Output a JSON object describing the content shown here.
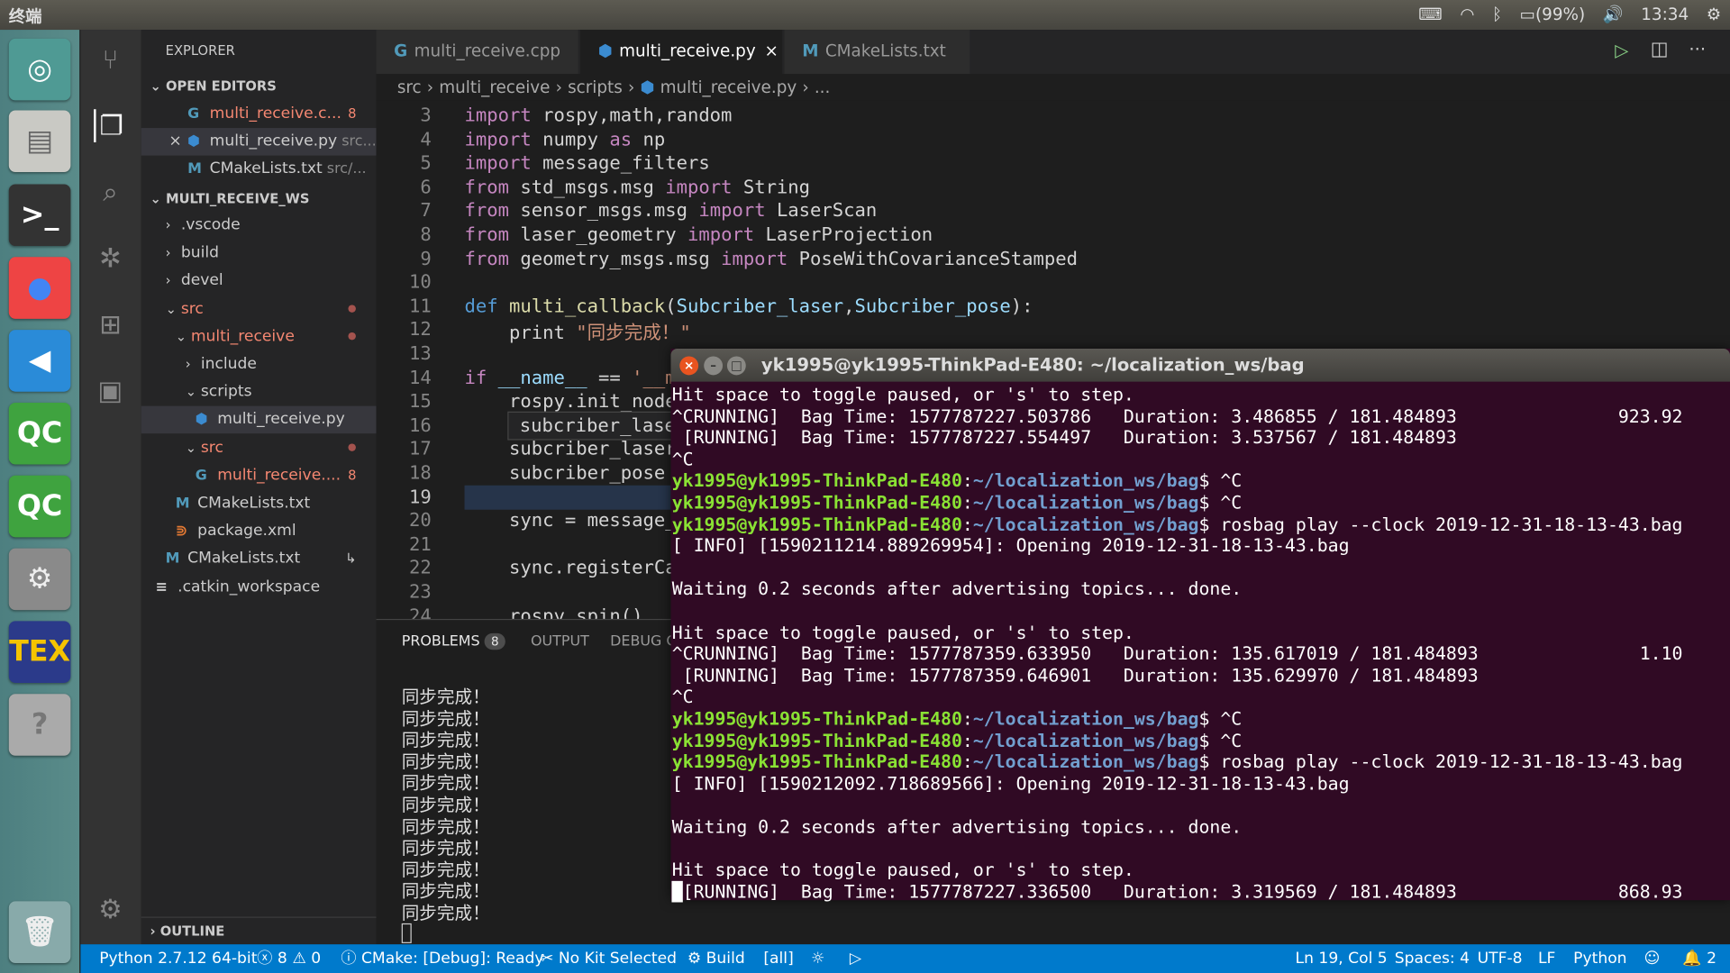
{
  "topbar": {
    "title": "终端",
    "battery": "(99%)",
    "time": "13:34",
    "icons": [
      "keyboard-icon",
      "wifi-icon",
      "bluetooth-icon",
      "battery-icon",
      "volume-icon",
      "power-gear-icon"
    ]
  },
  "launcher": [
    {
      "name": "ubuntu-dash",
      "glyph": "◎",
      "bg": "#4f9a94",
      "fg": "#fff"
    },
    {
      "name": "files",
      "glyph": "▤",
      "bg": "#c9c9c4",
      "fg": "#666"
    },
    {
      "name": "terminal",
      "glyph": ">_",
      "bg": "#333",
      "fg": "#fff"
    },
    {
      "name": "chrome",
      "glyph": "●",
      "bg": "#e44",
      "fg": "#4285f4"
    },
    {
      "name": "vscode",
      "glyph": "◀",
      "bg": "#2a8bd8",
      "fg": "#fff"
    },
    {
      "name": "qtcreator-1",
      "glyph": "QC",
      "bg": "#3fa33f",
      "fg": "#fff"
    },
    {
      "name": "qtcreator-2",
      "glyph": "QC",
      "bg": "#3fa33f",
      "fg": "#fff"
    },
    {
      "name": "system-settings",
      "glyph": "⚙",
      "bg": "#8a8a8a",
      "fg": "#eee"
    },
    {
      "name": "texstudio",
      "glyph": "TEX",
      "bg": "#2b3a8a",
      "fg": "#f5c400"
    },
    {
      "name": "help",
      "glyph": "?",
      "bg": "#aaa",
      "fg": "#777"
    },
    {
      "name": "trash",
      "glyph": "🗑",
      "bg": "#8aa",
      "fg": "#eee"
    }
  ],
  "activity": [
    "source-control-icon",
    "explorer-icon",
    "search-icon",
    "debug-icon",
    "extensions-icon",
    "remote-explorer-icon"
  ],
  "sidebar": {
    "title": "EXPLORER",
    "open_editors": "OPEN EDITORS",
    "workspace": "MULTI_RECEIVE_WS",
    "outline": "OUTLINE",
    "open_items": [
      {
        "label": "multi_receive.c...",
        "icon": "G",
        "iconColor": "#519aba",
        "color": "#f48771",
        "badge": "8",
        "dim": ""
      },
      {
        "label": "multi_receive.py",
        "icon": "⬢",
        "iconColor": "#3b8bd0",
        "color": "#ccc",
        "badge": "",
        "dim": " src...",
        "close": "×"
      },
      {
        "label": "CMakeLists.txt",
        "icon": "M",
        "iconColor": "#519aba",
        "color": "#ccc",
        "badge": "",
        "dim": " src/..."
      }
    ],
    "tree": [
      {
        "label": ".vscode",
        "chev": "›",
        "depth": 0,
        "color": "#ccc"
      },
      {
        "label": "build",
        "chev": "›",
        "depth": 0,
        "color": "#ccc"
      },
      {
        "label": "devel",
        "chev": "›",
        "depth": 0,
        "color": "#ccc"
      },
      {
        "label": "src",
        "chev": "⌄",
        "depth": 0,
        "color": "#f48771",
        "dot": "●"
      },
      {
        "label": "multi_receive",
        "chev": "⌄",
        "depth": 1,
        "color": "#f48771",
        "dot": "●"
      },
      {
        "label": "include",
        "chev": "›",
        "depth": 2,
        "color": "#ccc"
      },
      {
        "label": "scripts",
        "chev": "⌄",
        "depth": 2,
        "color": "#ccc"
      },
      {
        "label": "multi_receive.py",
        "icon": "⬢",
        "iconColor": "#3b8bd0",
        "depth": 3,
        "color": "#ccc",
        "sel": true
      },
      {
        "label": "src",
        "chev": "⌄",
        "depth": 2,
        "color": "#f48771",
        "dot": "●"
      },
      {
        "label": "multi_receive....",
        "icon": "G",
        "iconColor": "#519aba",
        "depth": 3,
        "color": "#f48771",
        "badge": "8"
      },
      {
        "label": "CMakeLists.txt",
        "icon": "M",
        "iconColor": "#519aba",
        "depth": 1,
        "color": "#ccc"
      },
      {
        "label": "package.xml",
        "icon": "⋑",
        "iconColor": "#e37933",
        "depth": 1,
        "color": "#ccc"
      },
      {
        "label": "CMakeLists.txt",
        "icon": "M",
        "iconColor": "#519aba",
        "depth": 0,
        "color": "#ccc",
        "badge": "↳"
      },
      {
        "label": ".catkin_workspace",
        "icon": "≡",
        "iconColor": "#ccc",
        "depth": -1,
        "color": "#ccc"
      }
    ]
  },
  "tabs": [
    {
      "label": "multi_receive.cpp",
      "icon": "G",
      "iconColor": "#519aba"
    },
    {
      "label": "multi_receive.py",
      "icon": "⬢",
      "iconColor": "#3b8bd0",
      "active": true,
      "close": "×"
    },
    {
      "label": "CMakeLists.txt",
      "icon": "M",
      "iconColor": "#519aba"
    }
  ],
  "breadcrumb": [
    "src",
    "multi_receive",
    "scripts",
    "multi_receive.py",
    "..."
  ],
  "editor": {
    "lines": [
      {
        "n": "3",
        "t": [
          [
            "import",
            "#c586c0"
          ],
          [
            " rospy,math,random",
            "#d4d4d4"
          ]
        ]
      },
      {
        "n": "4",
        "t": [
          [
            "import",
            "#c586c0"
          ],
          [
            " numpy ",
            "#d4d4d4"
          ],
          [
            "as",
            "#c586c0"
          ],
          [
            " np",
            "#d4d4d4"
          ]
        ]
      },
      {
        "n": "5",
        "t": [
          [
            "import",
            "#c586c0"
          ],
          [
            " message_filters",
            "#d4d4d4"
          ]
        ]
      },
      {
        "n": "6",
        "t": [
          [
            "from",
            "#c586c0"
          ],
          [
            " std_msgs.msg ",
            "#d4d4d4"
          ],
          [
            "import",
            "#c586c0"
          ],
          [
            " String",
            "#d4d4d4"
          ]
        ]
      },
      {
        "n": "7",
        "t": [
          [
            "from",
            "#c586c0"
          ],
          [
            " sensor_msgs.msg ",
            "#d4d4d4"
          ],
          [
            "import",
            "#c586c0"
          ],
          [
            " LaserScan",
            "#d4d4d4"
          ]
        ]
      },
      {
        "n": "8",
        "t": [
          [
            "from",
            "#c586c0"
          ],
          [
            " laser_geometry ",
            "#d4d4d4"
          ],
          [
            "import",
            "#c586c0"
          ],
          [
            " LaserProjection",
            "#d4d4d4"
          ]
        ]
      },
      {
        "n": "9",
        "t": [
          [
            "from",
            "#c586c0"
          ],
          [
            " geometry_msgs.msg ",
            "#d4d4d4"
          ],
          [
            "import",
            "#c586c0"
          ],
          [
            " PoseWithCovarianceStamped",
            "#d4d4d4"
          ]
        ]
      },
      {
        "n": "10",
        "t": []
      },
      {
        "n": "11",
        "t": [
          [
            "def",
            "#569cd6"
          ],
          [
            " ",
            "#d4d4d4"
          ],
          [
            "multi_callback",
            "#dcdcaa"
          ],
          [
            "(",
            "#d4d4d4"
          ],
          [
            "Subcriber_laser",
            "#9cdcfe"
          ],
          [
            ",",
            "#d4d4d4"
          ],
          [
            "Subcriber_pose",
            "#9cdcfe"
          ],
          [
            "):",
            "#d4d4d4"
          ]
        ]
      },
      {
        "n": "12",
        "t": [
          [
            "    print ",
            "#d4d4d4"
          ],
          [
            "\"同步完成！\"",
            "#ce9178"
          ]
        ]
      },
      {
        "n": "13",
        "t": []
      },
      {
        "n": "14",
        "t": [
          [
            "if",
            "#c586c0"
          ],
          [
            " __name__ ",
            "#9cdcfe"
          ],
          [
            "== ",
            "#d4d4d4"
          ],
          [
            "'__ma",
            "#ce9178"
          ]
        ]
      },
      {
        "n": "15",
        "t": [
          [
            "    rospy.init_node(",
            "#d4d4d4"
          ]
        ]
      },
      {
        "n": "16",
        "t": []
      },
      {
        "n": "17",
        "t": [
          [
            "    subcriber_laser",
            "#d4d4d4"
          ]
        ]
      },
      {
        "n": "18",
        "t": [
          [
            "    subcriber_pose",
            "#d4d4d4"
          ]
        ]
      },
      {
        "n": "19",
        "t": []
      },
      {
        "n": "20",
        "t": [
          [
            "    sync = message_",
            "#d4d4d4"
          ]
        ]
      },
      {
        "n": "21",
        "t": []
      },
      {
        "n": "22",
        "t": [
          [
            "    sync.registerCal",
            "#d4d4d4"
          ]
        ]
      },
      {
        "n": "23",
        "t": []
      },
      {
        "n": "24",
        "t": [
          [
            "    rospy.spin()",
            "#d4d4d4"
          ]
        ]
      }
    ],
    "suggestion": "subcriber_lase"
  },
  "panel": {
    "tabs": [
      "PROBLEMS",
      "OUTPUT",
      "DEBUG C"
    ],
    "problems_count": "8",
    "output": [
      "同步完成！",
      "同步完成！",
      "同步完成！",
      "同步完成！",
      "同步完成！",
      "同步完成！",
      "同步完成！",
      "同步完成！",
      "同步完成！",
      "同步完成！",
      "同步完成！"
    ]
  },
  "terminal": {
    "title": "yk1995@yk1995-ThinkPad-E480: ~/localization_ws/bag",
    "lines": [
      [
        [
          "Hit space to toggle paused, or 's' to step.",
          "#fff"
        ]
      ],
      [
        [
          "^CRUNNING]  Bag Time: 1577787227.503786   Duration: 3.486855 / 181.484893               923.92",
          "#fff"
        ]
      ],
      [
        [
          " [RUNNING]  Bag Time: 1577787227.554497   Duration: 3.537567 / 181.484893",
          "#fff"
        ]
      ],
      [
        [
          "^C",
          "#fff"
        ]
      ],
      [
        [
          "yk1995@yk1995-ThinkPad-E480",
          "#8ae234"
        ],
        [
          ":",
          "#fff"
        ],
        [
          "~/localization_ws/bag",
          "#729fcf"
        ],
        [
          "$ ^C",
          "#fff"
        ]
      ],
      [
        [
          "yk1995@yk1995-ThinkPad-E480",
          "#8ae234"
        ],
        [
          ":",
          "#fff"
        ],
        [
          "~/localization_ws/bag",
          "#729fcf"
        ],
        [
          "$ ^C",
          "#fff"
        ]
      ],
      [
        [
          "yk1995@yk1995-ThinkPad-E480",
          "#8ae234"
        ],
        [
          ":",
          "#fff"
        ],
        [
          "~/localization_ws/bag",
          "#729fcf"
        ],
        [
          "$ rosbag play --clock 2019-12-31-18-13-43.bag",
          "#fff"
        ]
      ],
      [
        [
          "[ INFO] [1590211214.889269954]: Opening 2019-12-31-18-13-43.bag",
          "#fff"
        ]
      ],
      [],
      [
        [
          "Waiting 0.2 seconds after advertising topics... done.",
          "#fff"
        ]
      ],
      [],
      [
        [
          "Hit space to toggle paused, or 's' to step.",
          "#fff"
        ]
      ],
      [
        [
          "^CRUNNING]  Bag Time: 1577787359.633950   Duration: 135.617019 / 181.484893               1.10",
          "#fff"
        ]
      ],
      [
        [
          " [RUNNING]  Bag Time: 1577787359.646901   Duration: 135.629970 / 181.484893",
          "#fff"
        ]
      ],
      [
        [
          "^C",
          "#fff"
        ]
      ],
      [
        [
          "yk1995@yk1995-ThinkPad-E480",
          "#8ae234"
        ],
        [
          ":",
          "#fff"
        ],
        [
          "~/localization_ws/bag",
          "#729fcf"
        ],
        [
          "$ ^C",
          "#fff"
        ]
      ],
      [
        [
          "yk1995@yk1995-ThinkPad-E480",
          "#8ae234"
        ],
        [
          ":",
          "#fff"
        ],
        [
          "~/localization_ws/bag",
          "#729fcf"
        ],
        [
          "$ ^C",
          "#fff"
        ]
      ],
      [
        [
          "yk1995@yk1995-ThinkPad-E480",
          "#8ae234"
        ],
        [
          ":",
          "#fff"
        ],
        [
          "~/localization_ws/bag",
          "#729fcf"
        ],
        [
          "$ rosbag play --clock 2019-12-31-18-13-43.bag",
          "#fff"
        ]
      ],
      [
        [
          "[ INFO] [1590212092.718689566]: Opening 2019-12-31-18-13-43.bag",
          "#fff"
        ]
      ],
      [],
      [
        [
          "Waiting 0.2 seconds after advertising topics... done.",
          "#fff"
        ]
      ],
      [],
      [
        [
          "Hit space to toggle paused, or 's' to step.",
          "#fff"
        ]
      ],
      [
        [
          "█[RUNNING]  Bag Time: 1577787227.336500   Duration: 3.319569 / 181.484893               868.93",
          "#fff"
        ]
      ]
    ]
  },
  "status": {
    "python": "Python 2.7.12 64-bit",
    "errors": "ⓧ 8",
    "warnings": "⚠ 0",
    "cmake": "ⓘ CMake: [Debug]: Ready",
    "kit": "✂ No Kit Selected",
    "build": "⚙ Build",
    "target": "[all]",
    "debug": "☼",
    "run": "▷",
    "position": "Ln 19, Col 5",
    "spaces": "Spaces: 4",
    "encoding": "UTF-8",
    "eol": "LF",
    "language": "Python",
    "feedback": "☺",
    "notifications": "🔔 2"
  },
  "colors": {
    "statusbar": "#007acc",
    "terminal_bg": "#300a24",
    "prompt_user": "#8ae234",
    "prompt_path": "#729fcf"
  }
}
